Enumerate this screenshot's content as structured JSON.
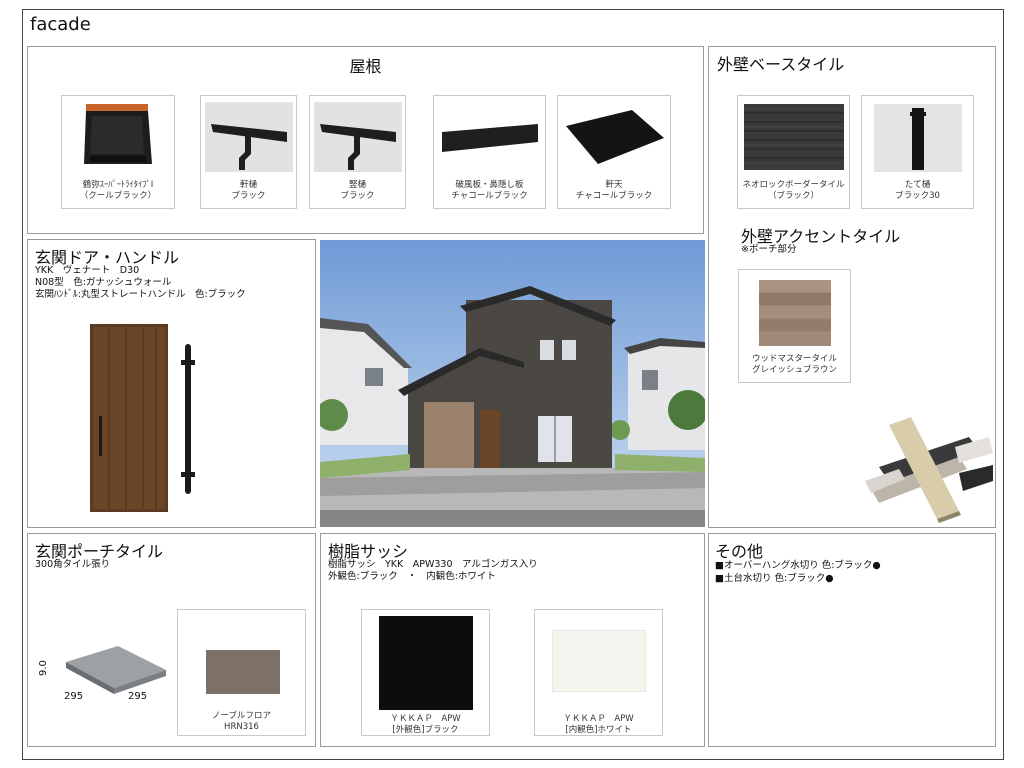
{
  "page": {
    "title": "facade"
  },
  "roof": {
    "title": "屋根",
    "items": [
      {
        "line1": "鶴弥ｽｰﾊﾟｰﾄﾗｲﾀｲﾌﾟⅠ",
        "line2": "（クールブラック）"
      },
      {
        "line1": "軒樋",
        "line2": "ブラック"
      },
      {
        "line1": "竪樋",
        "line2": "ブラック"
      },
      {
        "line1": "破風板・鼻隠し板",
        "line2": "チャコールブラック"
      },
      {
        "line1": "軒天",
        "line2": "チャコールブラック"
      }
    ]
  },
  "wall_base": {
    "title": "外壁ベースタイル",
    "items": [
      {
        "line1": "ネオロックボーダータイル",
        "line2": "（ブラック）"
      },
      {
        "line1": "たて樋",
        "line2": "ブラック30"
      }
    ]
  },
  "wall_accent": {
    "title": "外壁アクセントタイル",
    "subtitle": "※ポーチ部分",
    "item": {
      "line1": "ウッドマスタータイル",
      "line2": "グレイッシュブラウン"
    }
  },
  "door": {
    "title": "玄関ドア・ハンドル",
    "lines": [
      "YKK　ヴェナート　D30",
      "N08型　色:ガナッシュウォール",
      "玄関ﾊﾝﾄﾞﾙ:丸型ストレートハンドル　色:ブラック"
    ]
  },
  "porch": {
    "title": "玄関ポーチタイル",
    "subtitle": "300角タイル張り",
    "dims": {
      "thickness": "9.0",
      "w": "295",
      "d": "295"
    },
    "item": {
      "line1": "ノーブルフロア",
      "line2": "HRN316"
    }
  },
  "sash": {
    "title": "樹脂サッシ",
    "lines": [
      "樹脂サッシ　YKK　APW330　アルゴンガス入り",
      "外観色:ブラック　・　内観色:ホワイト"
    ],
    "items": [
      {
        "line1": "ＹＫＫＡＰ　APW",
        "line2": "[外観色]ブラック"
      },
      {
        "line1": "ＹＫＫＡＰ　APW",
        "line2": "[内観色]ホワイト"
      }
    ]
  },
  "other": {
    "title": "その他",
    "lines": [
      "■オーバーハング水切り  色:ブラック●",
      "■土台水切り  色:ブラック●"
    ]
  }
}
